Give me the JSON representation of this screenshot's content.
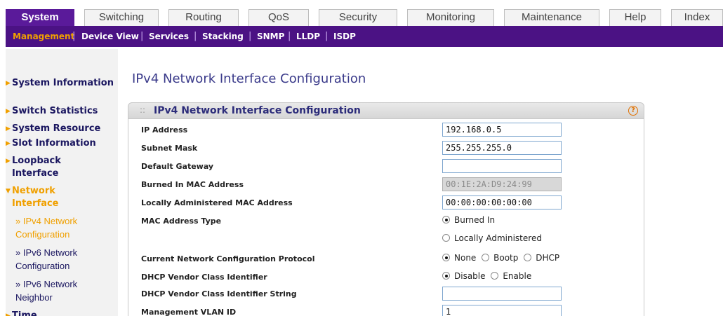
{
  "tabs": [
    {
      "label": "System",
      "active": true
    },
    {
      "label": "Switching"
    },
    {
      "label": "Routing"
    },
    {
      "label": "QoS"
    },
    {
      "label": "Security"
    },
    {
      "label": "Monitoring"
    },
    {
      "label": "Maintenance"
    },
    {
      "label": "Help"
    },
    {
      "label": "Index"
    }
  ],
  "submenu": [
    "Management",
    "Device View",
    "Services",
    "Stacking",
    "SNMP",
    "LLDP",
    "ISDP"
  ],
  "leftnav": {
    "items": [
      "System Information",
      "Switch Statistics",
      "System Resource",
      "Slot Information",
      "Loopback Interface",
      "Network Interface",
      "Time"
    ],
    "subitems": [
      "» IPv4 Network Configuration",
      "» IPv6 Network Configuration",
      "» IPv6 Network Neighbor"
    ]
  },
  "page_title": "IPv4 Network Interface Configuration",
  "panel": {
    "title": "IPv4 Network Interface Configuration",
    "help_icon": "?",
    "rows": [
      {
        "label": "IP Address",
        "value": "192.168.0.5"
      },
      {
        "label": "Subnet Mask",
        "value": "255.255.255.0"
      },
      {
        "label": "Default Gateway",
        "value": ""
      },
      {
        "label": "Burned In MAC Address",
        "value": "00:1E:2A:D9:24:99"
      },
      {
        "label": "Locally Administered MAC Address",
        "value": "00:00:00:00:00:00"
      },
      {
        "label": "MAC Address Type",
        "options": [
          "Burned In",
          "Locally Administered"
        ],
        "selected": "Burned In"
      },
      {
        "label": "Current Network Configuration Protocol",
        "options": [
          "None",
          "Bootp",
          "DHCP"
        ],
        "selected": "None"
      },
      {
        "label": "DHCP Vendor Class Identifier",
        "options": [
          "Disable",
          "Enable"
        ],
        "selected": "Disable"
      },
      {
        "label": "DHCP Vendor Class Identifier String",
        "value": ""
      },
      {
        "label": "Management VLAN ID",
        "value": "1"
      }
    ]
  },
  "colors": {
    "brand": "#4b1284",
    "accent": "#f0a000",
    "nav_text": "#1b1760"
  }
}
